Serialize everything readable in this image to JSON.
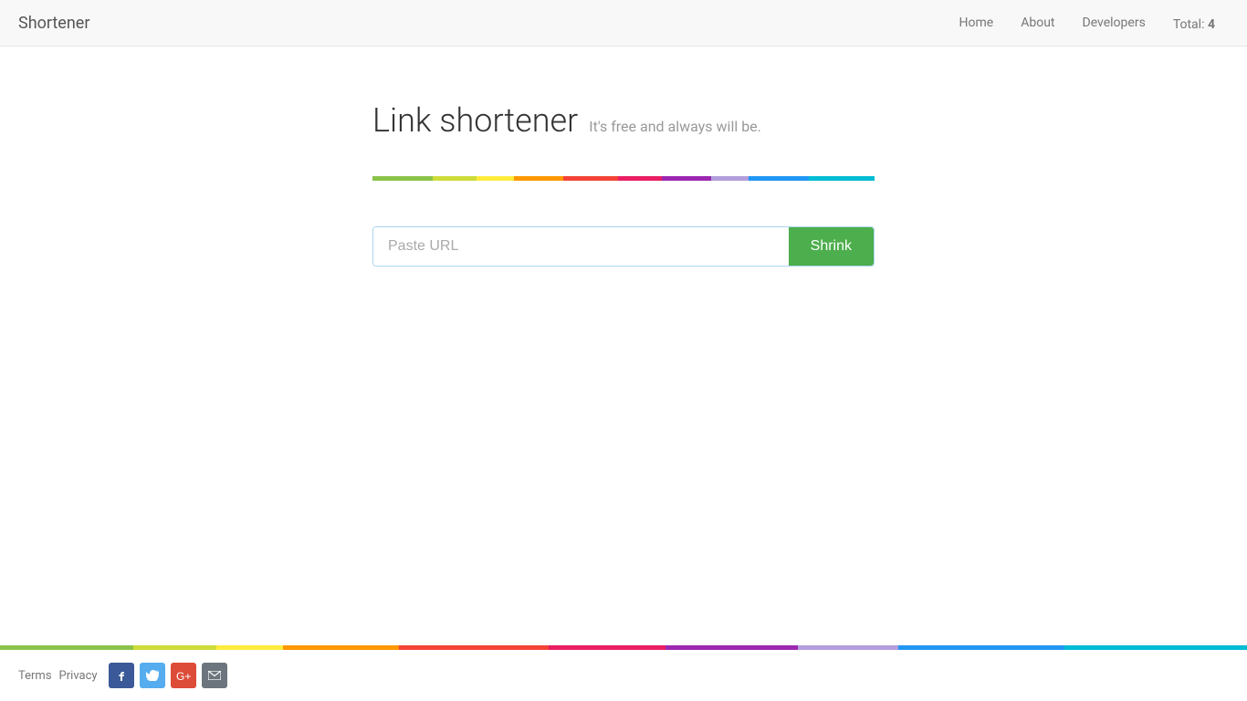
{
  "navbar": {
    "brand": "Shortener",
    "nav": [
      {
        "label": "Home",
        "href": "#"
      },
      {
        "label": "About",
        "href": "#"
      },
      {
        "label": "Developers",
        "href": "#"
      }
    ],
    "total_label": "Total:",
    "total_count": "4"
  },
  "hero": {
    "title": "Link shortener",
    "subtitle": "It's free and always will be."
  },
  "form": {
    "placeholder": "Paste URL",
    "button_label": "Shrink"
  },
  "footer": {
    "terms_label": "Terms",
    "privacy_label": "Privacy"
  },
  "rainbow_segments": [
    {
      "name": "green",
      "color": "#8bc34a"
    },
    {
      "name": "yellow-green",
      "color": "#cddc39"
    },
    {
      "name": "yellow",
      "color": "#ffeb3b"
    },
    {
      "name": "orange",
      "color": "#ff9800"
    },
    {
      "name": "red",
      "color": "#f44336"
    },
    {
      "name": "pink",
      "color": "#e91e63"
    },
    {
      "name": "purple",
      "color": "#9c27b0"
    },
    {
      "name": "lavender",
      "color": "#b39ddb"
    },
    {
      "name": "blue",
      "color": "#2196f3"
    },
    {
      "name": "cyan",
      "color": "#00bcd4"
    }
  ]
}
